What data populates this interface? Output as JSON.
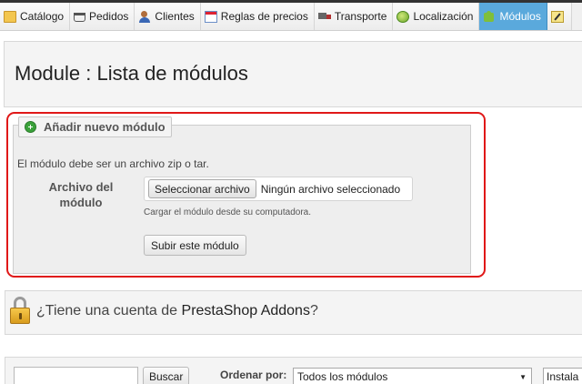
{
  "nav": {
    "tabs": [
      {
        "label": "Catálogo",
        "icon": "folder-icon",
        "active": false
      },
      {
        "label": "Pedidos",
        "icon": "cart-icon",
        "active": false
      },
      {
        "label": "Clientes",
        "icon": "user-icon",
        "active": false
      },
      {
        "label": "Reglas de precios",
        "icon": "price-rules-icon",
        "active": false
      },
      {
        "label": "Transporte",
        "icon": "truck-icon",
        "active": false
      },
      {
        "label": "Localización",
        "icon": "globe-icon",
        "active": false
      },
      {
        "label": "Módulos",
        "icon": "puzzle-icon",
        "active": true
      }
    ]
  },
  "page": {
    "title": "Module : Lista de módulos"
  },
  "upload": {
    "legend": "Añadir nuevo módulo",
    "description": "El módulo debe ser un archivo zip o tar.",
    "field_label_line1": "Archivo del",
    "field_label_line2": "módulo",
    "file_button": "Seleccionar archivo",
    "file_status": "Ningún archivo seleccionado",
    "hint": "Cargar el módulo desde su computadora.",
    "submit": "Subir este módulo"
  },
  "addons": {
    "prefix": "¿Tiene una cuenta de ",
    "brand": "PrestaShop Addons",
    "suffix": "?"
  },
  "filters": {
    "search_value": "",
    "search_button": "Buscar",
    "order_label": "Ordenar por:",
    "order_value": "Todos los módulos",
    "install_value": "Instala"
  },
  "colors": {
    "active_tab": "#5aa9dc",
    "highlight_border": "#e01818"
  }
}
